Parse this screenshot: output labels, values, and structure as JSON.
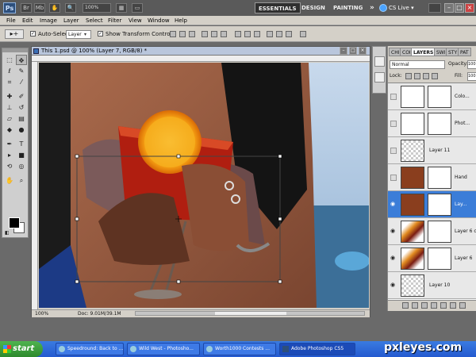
{
  "appbar": {
    "logo": "Ps",
    "zoom": "100%",
    "workspaces": [
      "ESSENTIALS",
      "DESIGN",
      "PAINTING"
    ],
    "more": "»",
    "cslive": "CS Live ▾"
  },
  "menu": [
    "File",
    "Edit",
    "Image",
    "Layer",
    "Select",
    "Filter",
    "View",
    "Window",
    "Help"
  ],
  "options": {
    "auto_select_label": "Auto-Select:",
    "auto_select_value": "Layer",
    "show_transform_label": "Show Transform Controls"
  },
  "document": {
    "title": "This 1.psd @ 100% (Layer 7, RGB/8) *",
    "zoom": "100%",
    "doc_size": "Doc: 9.01M/39.1M"
  },
  "layers_panel": {
    "tabs": [
      "CHI",
      "COI",
      "LAYERS",
      "SWI",
      "STY",
      "PAT"
    ],
    "blend_mode": "Normal",
    "opacity_label": "Opacity:",
    "opacity_value": "100",
    "lock_label": "Lock:",
    "fill_label": "Fill:",
    "fill_value": "100",
    "layers": [
      {
        "name": "Colo...",
        "visible": false,
        "selected": false,
        "thumb": "adj",
        "mask": true
      },
      {
        "name": "Phot...",
        "visible": false,
        "selected": false,
        "thumb": "adj",
        "mask": true
      },
      {
        "name": "Layer 11",
        "visible": false,
        "selected": false,
        "thumb": "trans",
        "mask": false
      },
      {
        "name": "Hand",
        "visible": false,
        "selected": false,
        "thumb": "hand",
        "mask": true
      },
      {
        "name": "Lay...",
        "visible": true,
        "selected": true,
        "thumb": "hand",
        "mask": true
      },
      {
        "name": "Layer 6 c...",
        "visible": true,
        "selected": false,
        "thumb": "fire",
        "mask": true
      },
      {
        "name": "Layer 6",
        "visible": true,
        "selected": false,
        "thumb": "fire",
        "mask": true
      },
      {
        "name": "Layer 10",
        "visible": true,
        "selected": false,
        "thumb": "trans",
        "mask": false
      }
    ]
  },
  "taskbar": {
    "start": "start",
    "tasks": [
      {
        "label": "Speedround: Back to ...",
        "active": false
      },
      {
        "label": "Wild West - Photosho...",
        "active": false
      },
      {
        "label": "Worth1000 Contests ...",
        "active": false
      },
      {
        "label": "Adobe Photoshop CS5",
        "active": true
      }
    ]
  },
  "watermark": "pxleyes.com"
}
